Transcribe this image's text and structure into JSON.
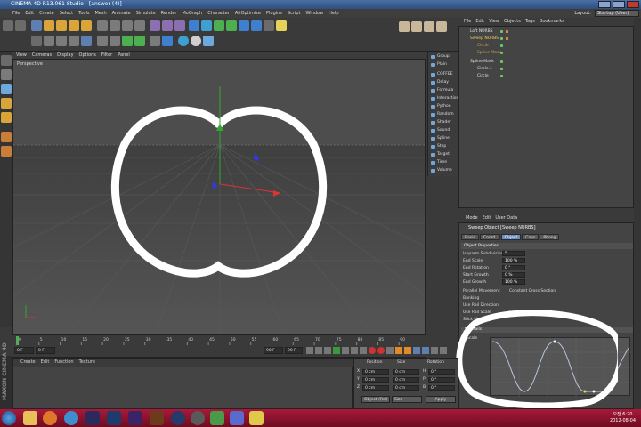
{
  "window": {
    "title": "CINEMA 4D R13.061 Studio - [answer (4)]"
  },
  "menubar": {
    "items": [
      "File",
      "Edit",
      "Create",
      "Select",
      "Tools",
      "Mesh",
      "Animate",
      "Simulate",
      "Render",
      "MoGraph",
      "Character",
      "AtiOptimize",
      "Plugins",
      "Script",
      "Window",
      "Help"
    ],
    "layout_label": "Layout:",
    "layout_value": "Startup (User)"
  },
  "viewport": {
    "menu": [
      "View",
      "Cameras",
      "Display",
      "Options",
      "Filter",
      "Panel"
    ],
    "label": "Perspective"
  },
  "object_palette": {
    "items": [
      "Group",
      "Plain",
      "COFFEE",
      "Delay",
      "Formula",
      "Interaction",
      "Python",
      "Random",
      "Shader",
      "Sound",
      "Spline",
      "Step",
      "Target",
      "Time",
      "Volume"
    ]
  },
  "object_manager": {
    "menu": [
      "File",
      "Edit",
      "View",
      "Objects",
      "Tags",
      "Bookmarks"
    ],
    "objects": [
      {
        "name": "Loft NURBS",
        "indent": 0
      },
      {
        "name": "Sweep NURBS",
        "indent": 0,
        "selected": true
      },
      {
        "name": "Circle",
        "indent": 1
      },
      {
        "name": "Spline Mask",
        "indent": 1
      },
      {
        "name": "Spline Mask",
        "indent": 0
      },
      {
        "name": "Circle.1",
        "indent": 1
      },
      {
        "name": "Circle",
        "indent": 1
      }
    ]
  },
  "attribute_manager": {
    "menu": [
      "Mode",
      "Edit",
      "User Data"
    ],
    "title": "Sweep Object [Sweep NURBS]",
    "tabs": [
      "Basic",
      "Coord.",
      "Object",
      "Caps",
      "Phong"
    ],
    "active_tab": "Object",
    "section": "Object Properties",
    "props": [
      {
        "label": "Isoparm Subdivision",
        "value": "5"
      },
      {
        "label": "End Scale",
        "value": "100 %"
      },
      {
        "label": "End Rotation",
        "value": "0 °"
      },
      {
        "label": "Start Growth",
        "value": "0 %"
      },
      {
        "label": "End Growth",
        "value": "100 %"
      }
    ],
    "checks": [
      {
        "label": "Parallel Movement",
        "label2": "Constant Cross Section"
      },
      {
        "label": "Banking",
        "label2": ""
      },
      {
        "label": "Use Rail Direction",
        "label2": ""
      },
      {
        "label": "Use Rail Scale",
        "label2": "Flip Normals"
      },
      {
        "label": "Stick Uvs",
        "label2": ""
      }
    ],
    "details_label": "▼Details",
    "graph_label": "Scale"
  },
  "timeline": {
    "ticks": [
      "0",
      "5",
      "10",
      "15",
      "20",
      "25",
      "30",
      "35",
      "40",
      "45",
      "50",
      "55",
      "60",
      "65",
      "70",
      "75",
      "80",
      "85",
      "90"
    ],
    "current_frame": "0 F",
    "start_frame": "0 F",
    "end_frame": "90 F",
    "end_field": "90 F"
  },
  "material_manager": {
    "menu": [
      "Create",
      "Edit",
      "Function",
      "Texture"
    ]
  },
  "coordinates": {
    "headers": [
      "Position",
      "Size",
      "Rotation"
    ],
    "rows": [
      {
        "axis": "X",
        "pos": "0 cm",
        "size": "0 cm",
        "rot_label": "H",
        "rot": "0 °"
      },
      {
        "axis": "Y",
        "pos": "0 cm",
        "size": "0 cm",
        "rot_label": "P",
        "rot": "0 °"
      },
      {
        "axis": "Z",
        "pos": "0 cm",
        "size": "0 cm",
        "rot_label": "B",
        "rot": "0 °"
      }
    ],
    "mode": "Object (Rel)",
    "size_mode": "Size",
    "apply": "Apply"
  },
  "taskbar": {
    "time": "오전 6:20",
    "date": "2012-08-04"
  },
  "brand": "MAXON CINEMA 4D"
}
